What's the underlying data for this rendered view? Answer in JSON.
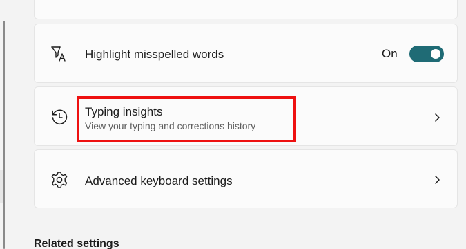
{
  "highlight_misspelled": {
    "title": "Highlight misspelled words",
    "state_label": "On",
    "toggle_on": true,
    "toggle_color": "#1f6b75"
  },
  "typing_insights": {
    "title": "Typing insights",
    "subtitle": "View your typing and corrections history"
  },
  "advanced_keyboard": {
    "title": "Advanced keyboard settings"
  },
  "related_settings": {
    "heading": "Related settings"
  },
  "annotation": {
    "highlight_color": "#ee1111"
  },
  "icons": {
    "highlight_misspelled": "spellcheck-icon",
    "typing_insights": "history-icon",
    "advanced_keyboard": "gear-icon",
    "chevron": "chevron-right-icon"
  }
}
